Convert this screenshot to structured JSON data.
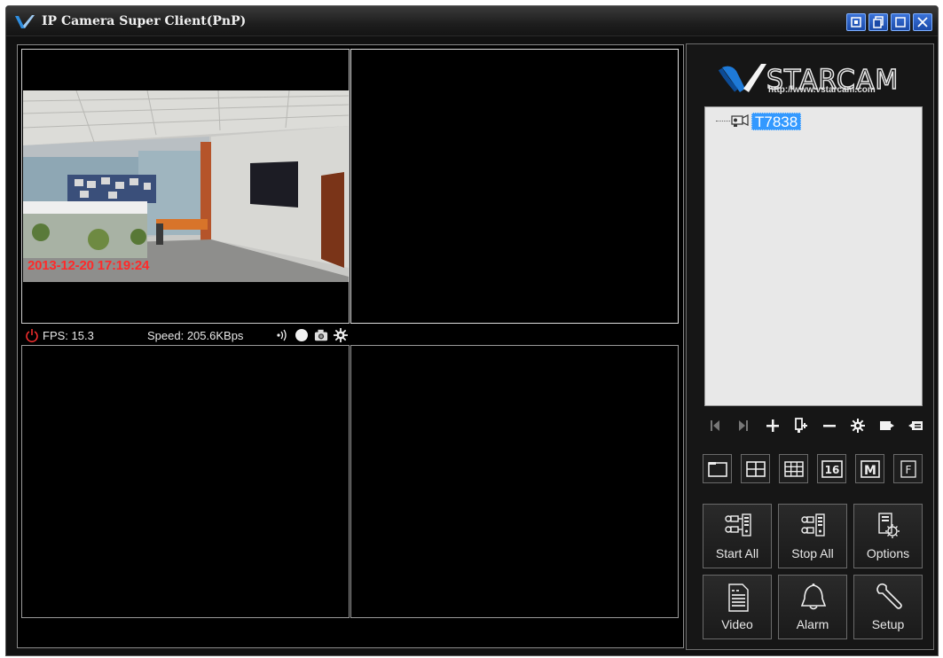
{
  "window": {
    "title": "IP Camera Super Client(PnP)"
  },
  "video_grid": {
    "cell1": {
      "timestamp": "2013-12-20 17:19:24"
    }
  },
  "status_bar": {
    "fps": "FPS: 15.3",
    "speed": "Speed: 205.6KBps"
  },
  "side_panel": {
    "logo_text": "VSTARCAM",
    "logo_url": "http://www.vstarcam.com",
    "device_tree": {
      "items": [
        {
          "label": "T7838",
          "selected": true
        }
      ]
    },
    "layout_buttons": [
      {
        "icon": "single-view-icon"
      },
      {
        "icon": "quad-view-icon"
      },
      {
        "icon": "nine-view-icon"
      },
      {
        "icon": "sixteen-view-icon",
        "label": "16"
      },
      {
        "icon": "m-view-icon",
        "label": "M"
      },
      {
        "icon": "fullscreen-icon",
        "label": "F"
      }
    ],
    "actions": {
      "start_all": "Start All",
      "stop_all": "Stop All",
      "options": "Options",
      "video": "Video",
      "alarm": "Alarm",
      "setup": "Setup"
    }
  },
  "colors": {
    "timestamp": "#ff2a2a",
    "selection": "#3399ff",
    "window_button": "#2a5cc8"
  }
}
